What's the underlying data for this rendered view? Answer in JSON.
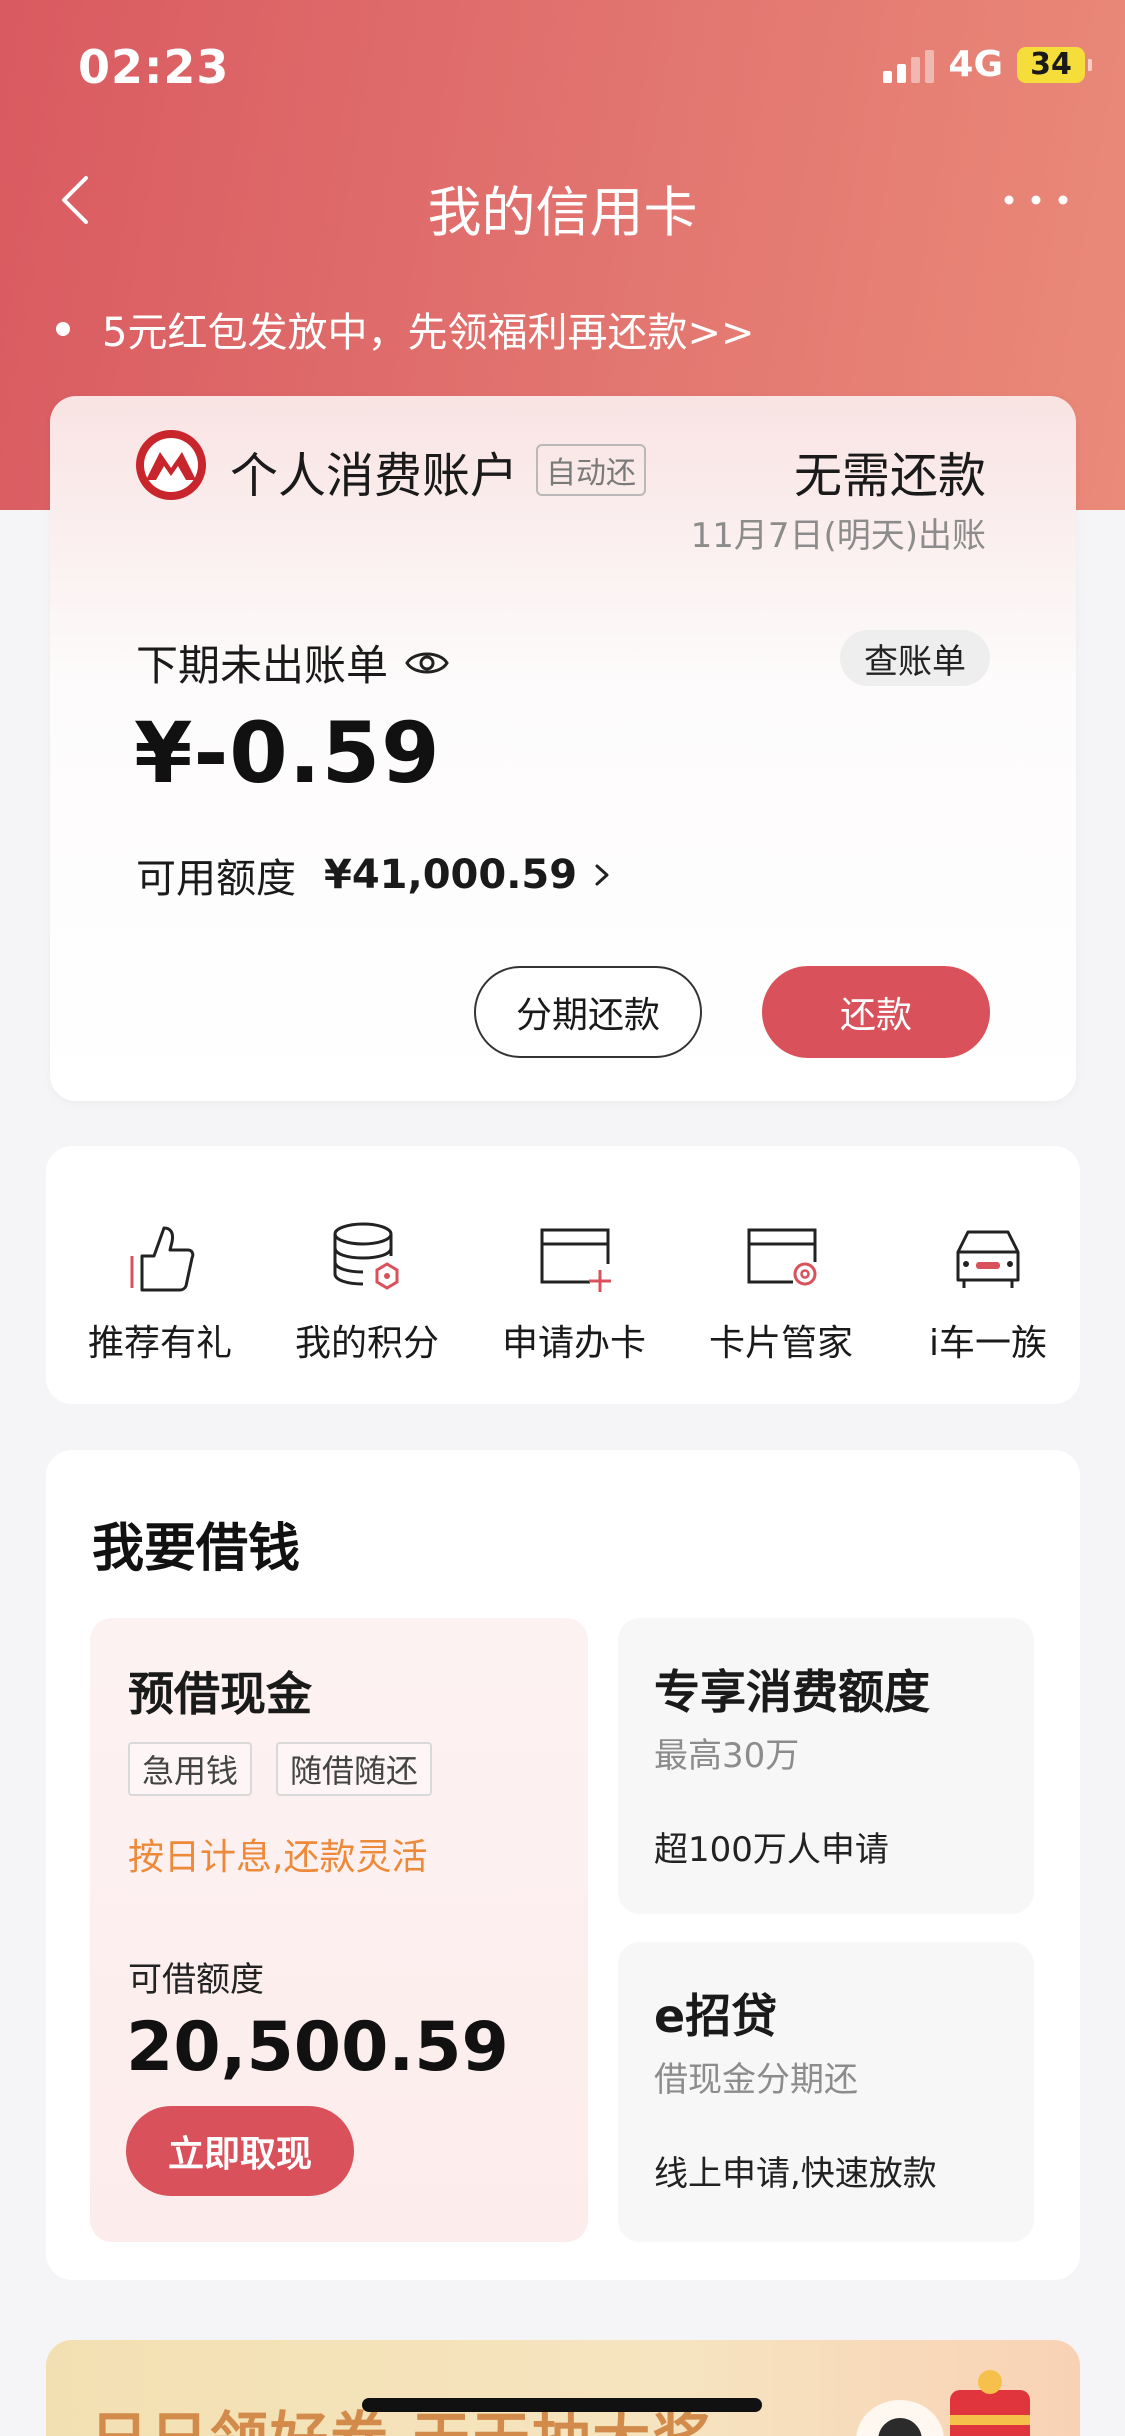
{
  "status_bar": {
    "time": "02:23",
    "network": "4G",
    "battery": "34"
  },
  "nav": {
    "title": "我的信用卡"
  },
  "promo": {
    "text": "5元红包发放中，先领福利再还款>>"
  },
  "account": {
    "name": "个人消费账户",
    "auto_tag": "自动还",
    "repay_status": "无需还款",
    "bill_date": "11月7日(明天)出账",
    "next_bill_label": "下期未出账单",
    "view_bill": "查账单",
    "amount": "¥-0.59",
    "credit_label": "可用额度",
    "credit_value": "¥41,000.59",
    "installment_button": "分期还款",
    "repay_button": "还款"
  },
  "shortcuts": [
    {
      "label": "推荐有礼",
      "icon": "thumbs-up-icon"
    },
    {
      "label": "我的积分",
      "icon": "points-coins-icon"
    },
    {
      "label": "申请办卡",
      "icon": "apply-card-icon"
    },
    {
      "label": "卡片管家",
      "icon": "card-manager-icon"
    },
    {
      "label": "i车一族",
      "icon": "car-icon"
    }
  ],
  "borrow": {
    "title": "我要借钱",
    "cash": {
      "title": "预借现金",
      "tags": [
        "急用钱",
        "随借随还"
      ],
      "desc": "按日计息,还款灵活",
      "quota_label": "可借额度",
      "quota": "20,500.59",
      "button": "立即取现"
    },
    "consumer": {
      "title": "专享消费额度",
      "sub": "最高30万",
      "desc": "超100万人申请"
    },
    "eloan": {
      "title": "e招贷",
      "sub": "借现金分期还",
      "desc": "线上申请,快速放款"
    }
  },
  "banner": {
    "text": "日日领好券 天天抽大奖"
  },
  "colors": {
    "brand_red": "#d9515a",
    "accent_orange": "#ec8a3a"
  }
}
